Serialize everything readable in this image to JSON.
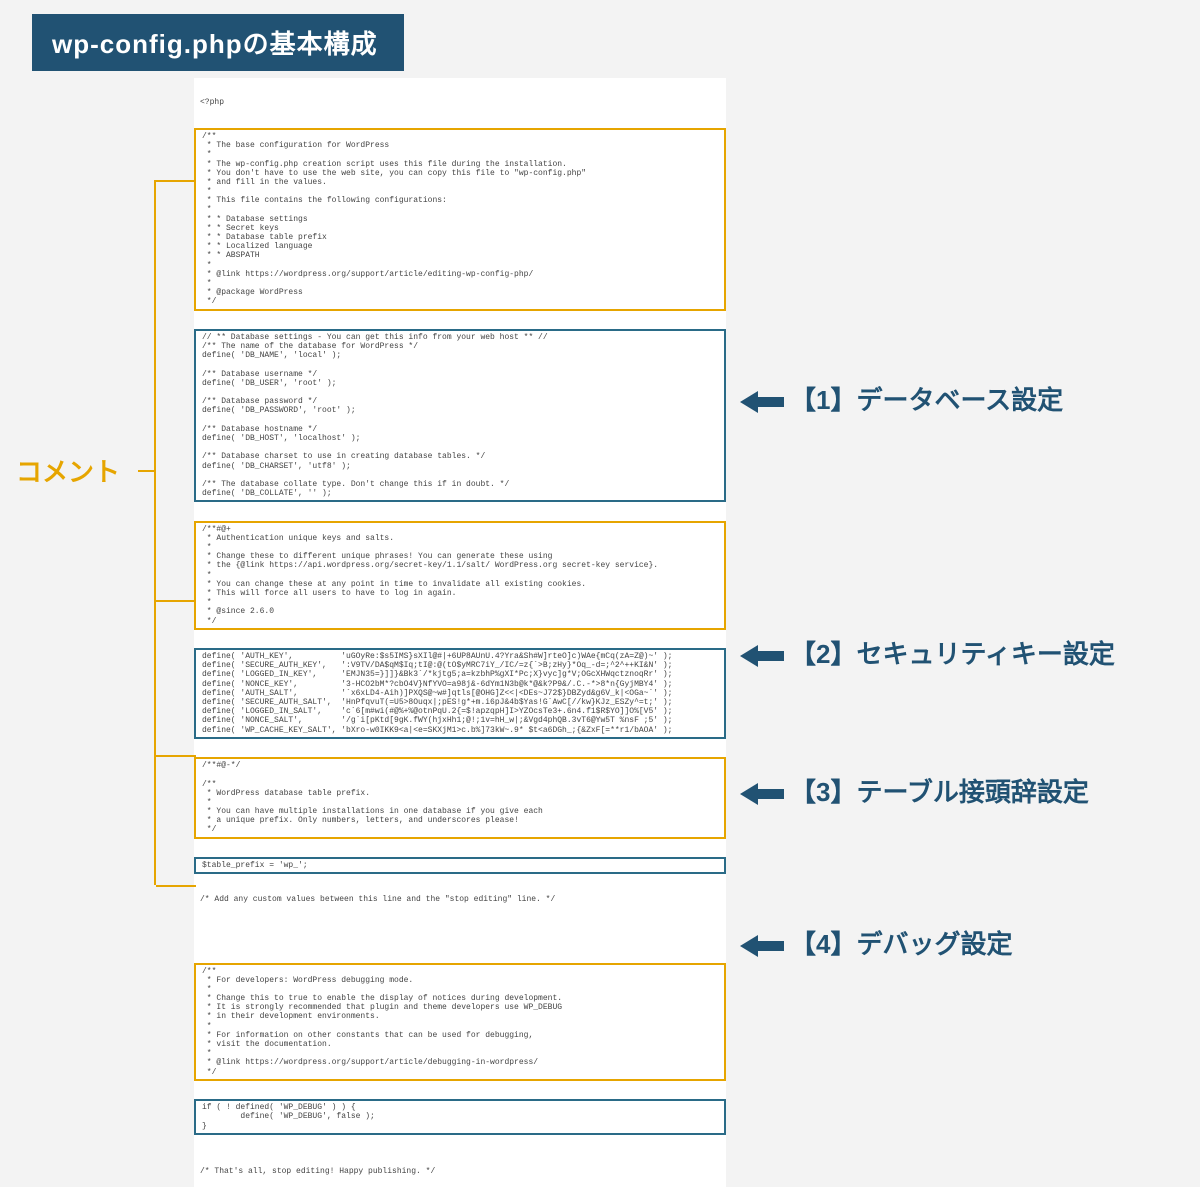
{
  "title": "wp-config.phpの基本構成",
  "left_label": "コメント",
  "labels": {
    "r1": "【1】データベース設定",
    "r2": "【2】セキュリティキー設定",
    "r3": "【3】テーブル接頭辞設定",
    "r4": "【4】デバッグ設定"
  },
  "code": {
    "php_open": "<?php",
    "header_comment": "/**\n * The base configuration for WordPress\n *\n * The wp-config.php creation script uses this file during the installation.\n * You don't have to use the web site, you can copy this file to \"wp-config.php\"\n * and fill in the values.\n *\n * This file contains the following configurations:\n *\n * * Database settings\n * * Secret keys\n * * Database table prefix\n * * Localized language\n * * ABSPATH\n *\n * @link https://wordpress.org/support/article/editing-wp-config-php/\n *\n * @package WordPress\n */",
    "db_block": "// ** Database settings - You can get this info from your web host ** //\n/** The name of the database for WordPress */\ndefine( 'DB_NAME', 'local' );\n\n/** Database username */\ndefine( 'DB_USER', 'root' );\n\n/** Database password */\ndefine( 'DB_PASSWORD', 'root' );\n\n/** Database hostname */\ndefine( 'DB_HOST', 'localhost' );\n\n/** Database charset to use in creating database tables. */\ndefine( 'DB_CHARSET', 'utf8' );\n\n/** The database collate type. Don't change this if in doubt. */\ndefine( 'DB_COLLATE', '' );",
    "auth_comment": "/**#@+\n * Authentication unique keys and salts.\n *\n * Change these to different unique phrases! You can generate these using\n * the {@link https://api.wordpress.org/secret-key/1.1/salt/ WordPress.org secret-key service}.\n *\n * You can change these at any point in time to invalidate all existing cookies.\n * This will force all users to have to log in again.\n *\n * @since 2.6.0\n */",
    "auth_keys": "define( 'AUTH_KEY',          'uGOyRe:$s5IMS}sXIl@#|+6UP8AUnU.4?Yra&Sh#W]rteO]c)WAe{mCq(zA=Z@)~' );\ndefine( 'SECURE_AUTH_KEY',   ':V9TV/DA$qM$Iq;tI@:@(tO$yMRC7iY_/IC/=z{`>B;zHy}*Oq_-d=;^2^++KI&N' );\ndefine( 'LOGGED_IN_KEY',     'EMJN35=}]]}&Bk3`/*kjtg5;a=kzbhP%gXI*Pc;X}vyc]g*V;OGcXHWqctznoqRr' );\ndefine( 'NONCE_KEY',         '3-HCO2bM*?cbO4V}NfYVO=a98j&-6dYm1N3b@k*@&k?P9&/.C.-*>8*n{GyjMBY4' );\ndefine( 'AUTH_SALT',         '`x6xLD4-Aih)]PXQS@~w#]qtls[@OHG]Z<<|<DEs~J72$}DBZyd&g6V_k|<OGa~`' );\ndefine( 'SECURE_AUTH_SALT',  'HnPfqvuT(=U5>8Ouqx|;pES!g*+m.i6pJ&4b$Yas!G`AwC[//kw}KJz_ESZy^=t;' );\ndefine( 'LOGGED_IN_SALT',    'c`6[m#wi(#@%+%@otnPqU.2{=$!apzqpH]I>YZOcsTe3+.6n4.f1$R$YO]]O%[V5' );\ndefine( 'NONCE_SALT',        '/g`i[pKtd[9gK.fWY(hjxHh1;@!;1v=hH_w|;&Vgd4phQB.3vT6@Yw5T %nsF ;5' );\ndefine( 'WP_CACHE_KEY_SALT', 'bXro-w0IKK9<a|<e=SKXjM1>c.b%]73kW~.9* $t<a6DGh_;{&ZxF[=**r1/bAOA' );",
    "prefix_comment": "/**#@-*/\n\n/**\n * WordPress database table prefix.\n *\n * You can have multiple installations in one database if you give each\n * a unique prefix. Only numbers, letters, and underscores please!\n */",
    "table_prefix": "$table_prefix = 'wp_';",
    "custom_note": "/* Add any custom values between this line and the \"stop editing\" line. */",
    "debug_comment": "/**\n * For developers: WordPress debugging mode.\n *\n * Change this to true to enable the display of notices during development.\n * It is strongly recommended that plugin and theme developers use WP_DEBUG\n * in their development environments.\n *\n * For information on other constants that can be used for debugging,\n * visit the documentation.\n *\n * @link https://wordpress.org/support/article/debugging-in-wordpress/\n */",
    "debug_block": "if ( ! defined( 'WP_DEBUG' ) ) {\n        define( 'WP_DEBUG', false );\n}",
    "end_note": "/* That's all, stop editing! Happy publishing. */"
  }
}
